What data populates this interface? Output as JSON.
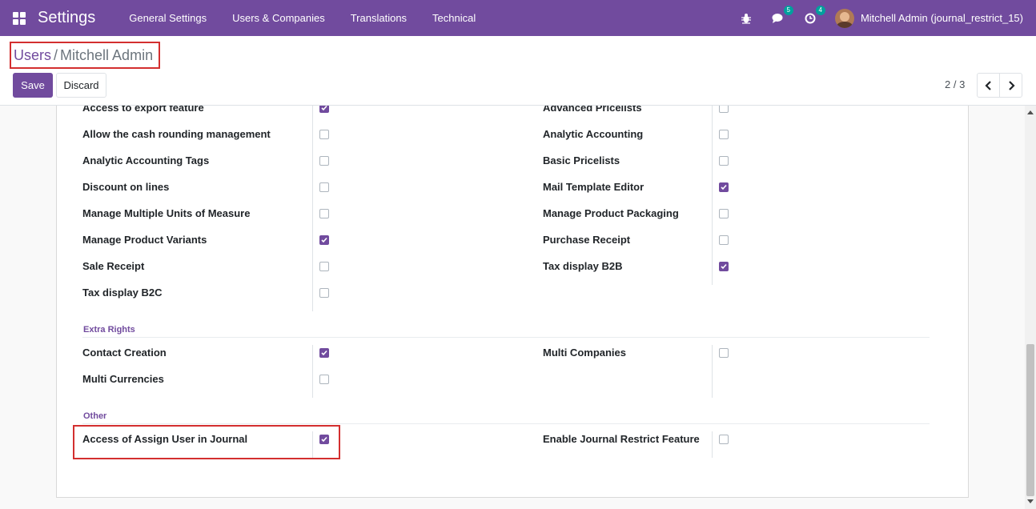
{
  "navbar": {
    "app_title": "Settings",
    "menu": [
      "General Settings",
      "Users & Companies",
      "Translations",
      "Technical"
    ],
    "messages_count": "5",
    "activities_count": "4",
    "user_name": "Mitchell Admin (journal_restrict_15)"
  },
  "breadcrumb": {
    "parent": "Users",
    "separator": "/",
    "current": "Mitchell Admin"
  },
  "buttons": {
    "save": "Save",
    "discard": "Discard"
  },
  "pager": {
    "value": "2 / 3"
  },
  "technical_settings": {
    "left": [
      {
        "label": "Access to export feature",
        "checked": true
      },
      {
        "label": "Allow the cash rounding management",
        "checked": false
      },
      {
        "label": "Analytic Accounting Tags",
        "checked": false
      },
      {
        "label": "Discount on lines",
        "checked": false
      },
      {
        "label": "Manage Multiple Units of Measure",
        "checked": false
      },
      {
        "label": "Manage Product Variants",
        "checked": true
      },
      {
        "label": "Sale Receipt",
        "checked": false
      },
      {
        "label": "Tax display B2C",
        "checked": false
      }
    ],
    "right": [
      {
        "label": "Advanced Pricelists",
        "checked": false
      },
      {
        "label": "Analytic Accounting",
        "checked": false
      },
      {
        "label": "Basic Pricelists",
        "checked": false
      },
      {
        "label": "Mail Template Editor",
        "checked": true
      },
      {
        "label": "Manage Product Packaging",
        "checked": false
      },
      {
        "label": "Purchase Receipt",
        "checked": false
      },
      {
        "label": "Tax display B2B",
        "checked": true
      }
    ]
  },
  "extra_rights": {
    "title": "Extra Rights",
    "left": [
      {
        "label": "Contact Creation",
        "checked": true
      },
      {
        "label": "Multi Currencies",
        "checked": false
      }
    ],
    "right": [
      {
        "label": "Multi Companies",
        "checked": false
      }
    ]
  },
  "other": {
    "title": "Other",
    "left": [
      {
        "label": "Access of Assign User in Journal",
        "checked": true
      }
    ],
    "right": [
      {
        "label": "Enable Journal Restrict Feature",
        "checked": false
      }
    ]
  },
  "colors": {
    "brand": "#714b9e",
    "highlight_border": "#d32f2f",
    "badge": "#00a09d"
  }
}
